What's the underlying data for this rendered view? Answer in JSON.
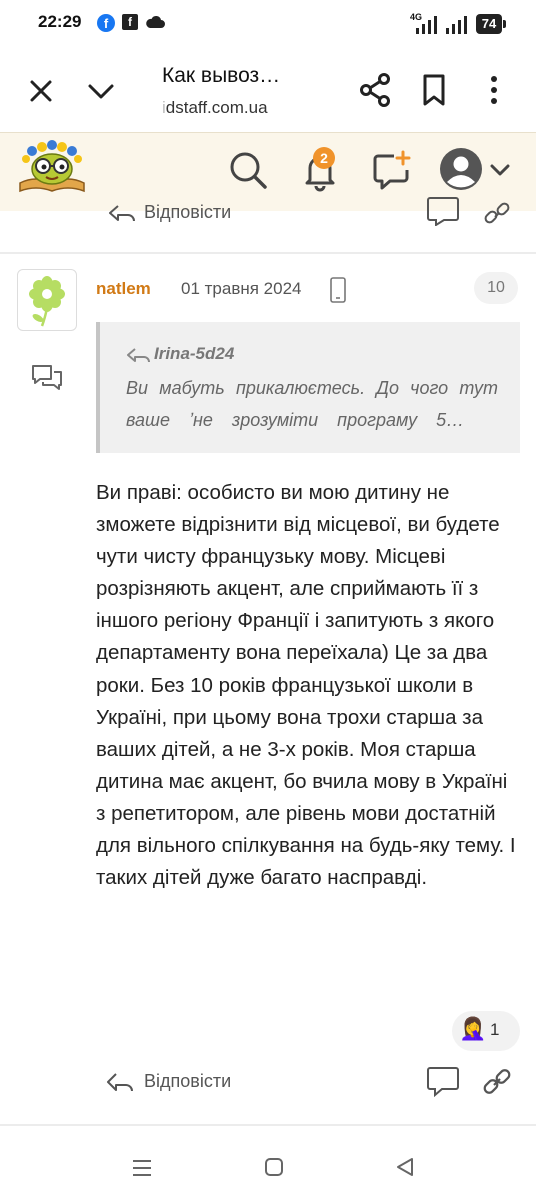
{
  "status_bar": {
    "time": "22:29",
    "network": "4G",
    "battery": "74",
    "icons": [
      "facebook-icon",
      "facebook-square-icon",
      "cloud-icon",
      "signal-icon",
      "battery-icon"
    ]
  },
  "browser": {
    "tab_title": "Как вывоз…",
    "url_faded": "i",
    "url": "dstaff.com.ua",
    "icons": [
      "close-icon",
      "chevron-down-icon",
      "share-icon",
      "bookmark-icon",
      "more-vert-icon"
    ]
  },
  "site_header": {
    "notification_count": "2",
    "icons": [
      "search-icon",
      "bell-icon",
      "new-message-icon",
      "user-avatar-icon",
      "chevron-down-icon"
    ]
  },
  "prev_post": {
    "reply_label": "Відповісти"
  },
  "post": {
    "username": "natlem",
    "date": "01 травня 2024",
    "number": "10",
    "quote": {
      "author": "Irina-5d24",
      "line1": "Ви мабуть прикалюєтесь. До чого тут",
      "line2": "ваше ʼне зрозуміти програму 5…"
    },
    "body": "Ви праві: особисто ви мою дитину не зможете відрізнити від місцевої, ви будете чути чисту французьку мову. Місцеві розрізняють акцент, але сприймають її з іншого регіону Франції і запитують з якого департаменту вона переїхала) Це за два роки. Без 10 років французької школи в Україні, при цьому вона трохи старша за ваших дітей, а не 3-х років. Моя старша дитина має акцент, бо вчила мову в Україні з репетитором, але рівень мови достатній для вільного спілкування на будь-яку тему. І таких дітей дуже багато насправді.",
    "reaction": {
      "emoji": "🤦‍♀️",
      "count": "1"
    },
    "reply_label": "Відповісти"
  },
  "colors": {
    "accent": "#d17a16",
    "badge": "#f0932b",
    "header_bg": "#fbf6ea",
    "quote_bg": "#f0f0f0"
  }
}
